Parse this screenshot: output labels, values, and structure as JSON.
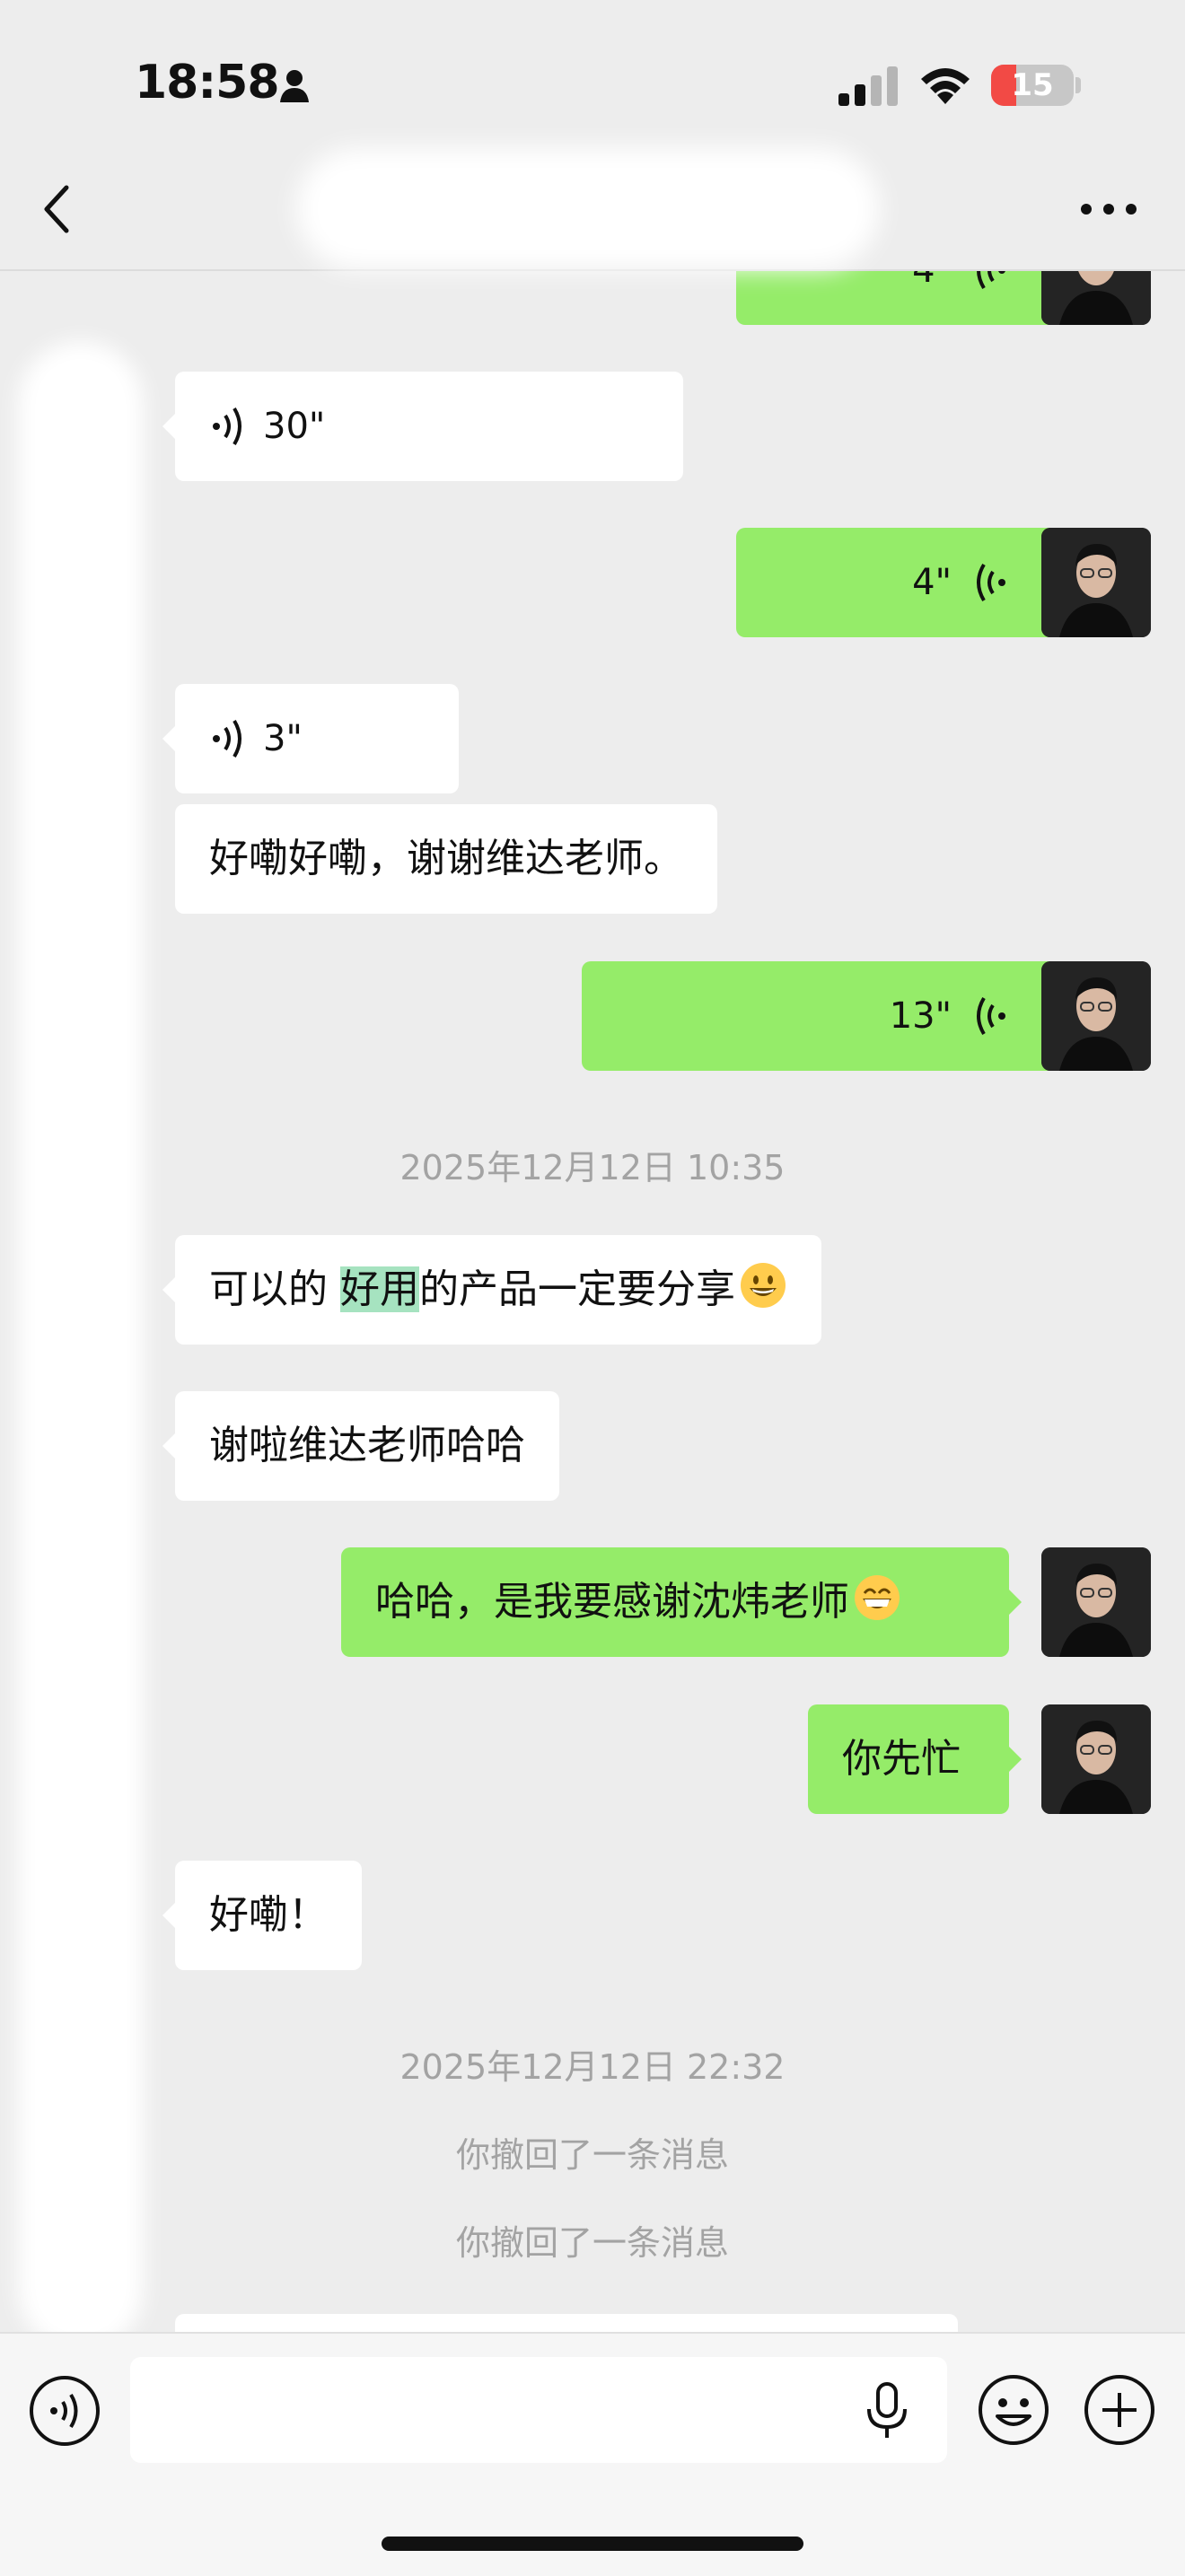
{
  "status_bar": {
    "time": "18:58",
    "battery_level": "15",
    "battery_fraction": 0.15,
    "battery_color": "#f24a45"
  },
  "nav": {
    "back_icon": "chevron-left-icon",
    "title": "",
    "more_icon": "more-dots-icon"
  },
  "colors": {
    "outgoing_bubble": "#95ec69",
    "incoming_bubble": "#ffffff",
    "background": "#ededed",
    "highlight": "#a6e3c0"
  },
  "messages": [
    {
      "type": "voice",
      "direction": "out",
      "duration": "4\""
    },
    {
      "type": "voice",
      "direction": "in",
      "duration": "30\""
    },
    {
      "type": "voice",
      "direction": "out",
      "duration": "4\""
    },
    {
      "type": "voice",
      "direction": "in",
      "duration": "3\""
    },
    {
      "type": "text",
      "direction": "in",
      "text": "好嘞好嘞，谢谢维达老师。"
    },
    {
      "type": "voice",
      "direction": "out",
      "duration": "13\""
    },
    {
      "type": "timestamp",
      "text": "2025年12月12日 10:35"
    },
    {
      "type": "text",
      "direction": "in",
      "text_before": "可以的 ",
      "highlight": "好用",
      "text_after": "的产品一定要分享",
      "emoji": "grinning-face-emoji"
    },
    {
      "type": "text",
      "direction": "in",
      "text": "谢啦维达老师哈哈"
    },
    {
      "type": "text",
      "direction": "out",
      "text": "哈哈，是我要感谢沈炜老师",
      "emoji": "beaming-face-emoji"
    },
    {
      "type": "text",
      "direction": "out",
      "text": "你先忙"
    },
    {
      "type": "text",
      "direction": "in",
      "text": "好嘞！"
    },
    {
      "type": "timestamp",
      "text": "2025年12月12日 22:32"
    },
    {
      "type": "system",
      "text": "你撤回了一条消息"
    },
    {
      "type": "system",
      "text": "你撤回了一条消息"
    }
  ],
  "input_bar": {
    "placeholder": "",
    "value": ""
  }
}
